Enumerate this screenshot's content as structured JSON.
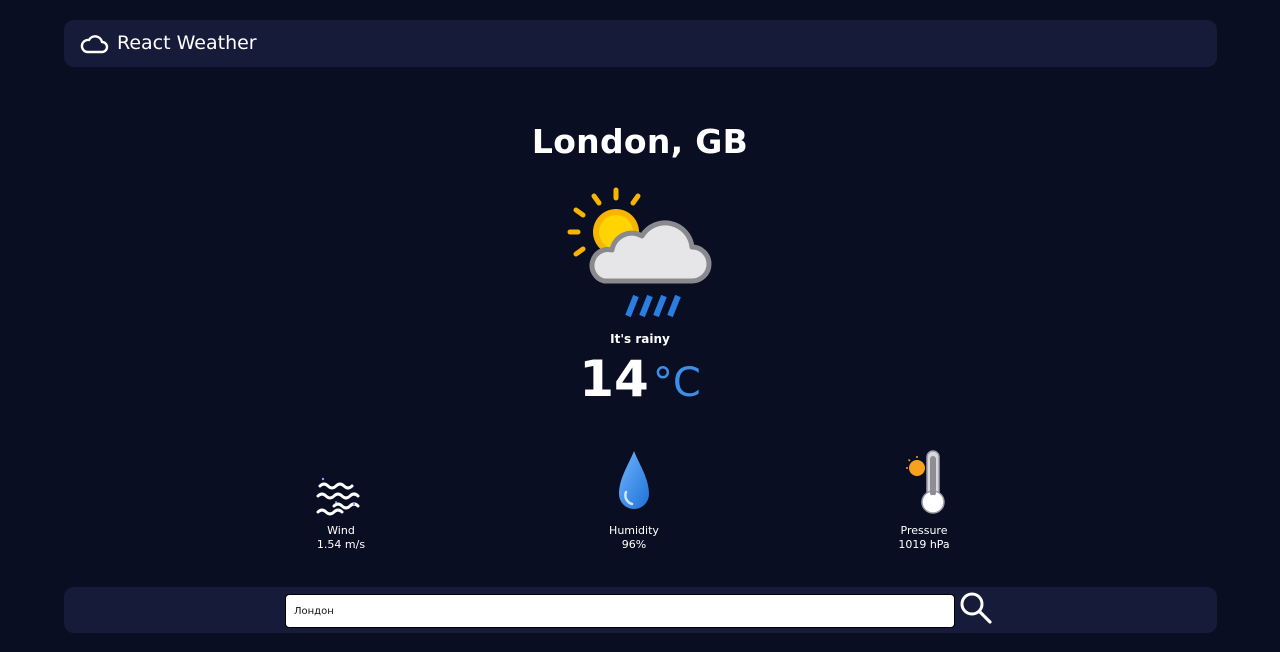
{
  "header": {
    "logo_icon": "cloud-icon",
    "title": "React Weather"
  },
  "weather": {
    "city": "London, GB",
    "icon": "sun-cloud-rain-icon",
    "condition": "It's rainy",
    "temperature": "14",
    "unit": "°C"
  },
  "stats": {
    "wind": {
      "icon": "wind-icon",
      "label": "Wind",
      "value": "1.54 m/s"
    },
    "humidity": {
      "icon": "water-drop-icon",
      "label": "Humidity",
      "value": "96%"
    },
    "pressure": {
      "icon": "thermometer-icon",
      "label": "Pressure",
      "value": "1019 hPa"
    }
  },
  "search": {
    "value": "Лондон",
    "button_icon": "search-icon"
  },
  "colors": {
    "background": "#0a0e22",
    "panel": "#161b39",
    "accent": "#3d8ee6",
    "sun": "#f7b500",
    "rain": "#2a7de1"
  }
}
